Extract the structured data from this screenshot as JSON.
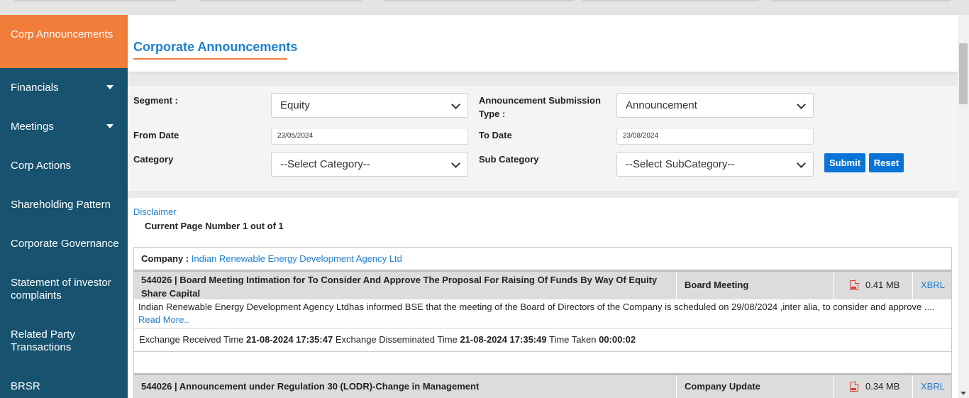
{
  "sidebar": {
    "active": "Corp Announcements",
    "items": [
      {
        "label": "Financials",
        "has_caret": true
      },
      {
        "label": "Meetings",
        "has_caret": true
      },
      {
        "label": "Corp Actions"
      },
      {
        "label": "Shareholding Pattern"
      },
      {
        "label": "Corporate Governance"
      },
      {
        "label": "Statement of investor complaints"
      },
      {
        "label": "Related Party Transactions"
      },
      {
        "label": "BRSR"
      }
    ],
    "collapse_glyph": "‹"
  },
  "page": {
    "title": "Corporate Announcements"
  },
  "form": {
    "segment_label": "Segment :",
    "segment_value": "Equity",
    "submission_type_label": "Announcement Submission Type :",
    "submission_type_value": "Announcement",
    "from_date_label": "From Date",
    "from_date_value": "23/05/2024",
    "to_date_label": "To Date",
    "to_date_value": "23/08/2024",
    "category_label": "Category",
    "category_value": "--Select Category--",
    "subcategory_label": "Sub Category",
    "subcategory_value": "--Select SubCategory--",
    "submit_label": "Submit",
    "reset_label": "Reset"
  },
  "list": {
    "disclaimer": "Disclaimer",
    "page_info": "Current Page Number 1 out of 1",
    "company_label": "Company :",
    "company_name": "Indian Renewable Energy Development Agency Ltd",
    "announcements": [
      {
        "subject": "544026  |  Board Meeting Intimation for To Consider And Approve The Proposal For Raising Of Funds By Way Of Equity Share Capital",
        "category": "Board Meeting",
        "size": "0.41 MB",
        "xbrl": "XBRL",
        "body": "Indian Renewable Energy Development Agency Ltdhas informed BSE that the meeting of the Board of Directors of the Company is scheduled on 29/08/2024 ,inter alia, to consider and approve ....",
        "read_more": "Read More..",
        "received_label": "Exchange Received Time",
        "received_time": "21-08-2024 17:35:47",
        "disseminated_label": "Exchange Disseminated Time",
        "disseminated_time": "21-08-2024 17:35:49",
        "taken_label": "Time Taken",
        "taken_time": "00:00:02"
      },
      {
        "subject": "544026  |  Announcement under Regulation 30 (LODR)-Change in Management",
        "category": "Company Update",
        "size": "0.34 MB",
        "xbrl": "XBRL"
      }
    ]
  },
  "colors": {
    "sidebar_bg": "#17536f",
    "accent_orange": "#f07d3a",
    "link_blue": "#1f7fcf",
    "button_blue": "#0a74d6"
  }
}
